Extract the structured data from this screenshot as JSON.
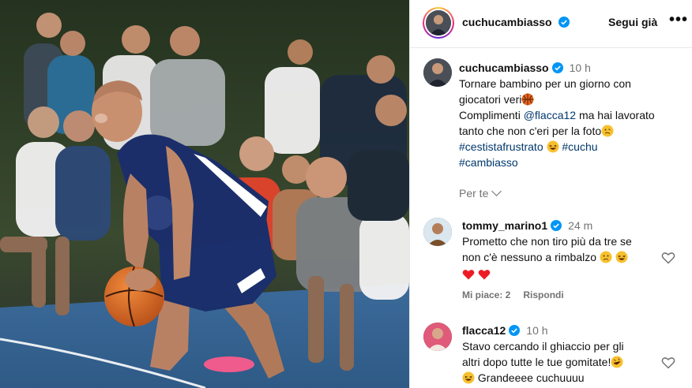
{
  "post": {
    "username": "cuchucambiasso",
    "follow_label": "Segui già",
    "more_label": "•••",
    "caption": {
      "username": "cuchucambiasso",
      "time": "10 h",
      "line1": "Tornare bambino per un giorno con",
      "line2": "giocatori veri",
      "line3_pre": "Complimenti ",
      "mention": "@flacca12",
      "line3_post": " ma hai lavorato",
      "line4": "tanto che non c'eri per la foto",
      "hashtag1": "#cestistafrustrato",
      "hashtag2": "#cuchu",
      "hashtag3": "#cambiasso"
    },
    "per_te_label": "Per te"
  },
  "comments": [
    {
      "username": "tommy_marino1",
      "time": "24 m",
      "line1": "Prometto che non tiro più da tre se",
      "line2": "non c'è nessuno a rimbalzo",
      "likes_label": "Mi piace: 2",
      "reply_label": "Rispondi"
    },
    {
      "username": "flacca12",
      "time": "10 h",
      "line1": "Stavo cercando il ghiaccio per gli",
      "line2": "altri dopo tutte le tue gomitate!",
      "line3": "Grandeeee cuchuuuu"
    }
  ],
  "colors": {
    "verified": "#0095f6",
    "hashtag": "#00376b",
    "muted": "#737373",
    "heart_red": "#ed1c24"
  }
}
